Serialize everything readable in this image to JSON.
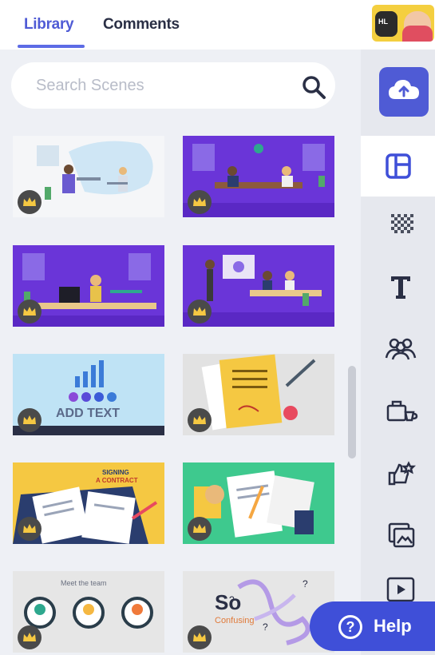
{
  "header": {
    "tabs": [
      {
        "label": "Library",
        "active": true
      },
      {
        "label": "Comments",
        "active": false
      }
    ],
    "avatar_badge": "HL"
  },
  "search": {
    "placeholder": "Search Scenes"
  },
  "scenes": [
    {
      "name": "office-desk-scene",
      "premium": true
    },
    {
      "name": "meeting-table-scene",
      "premium": true
    },
    {
      "name": "workspace-desk-scene",
      "premium": true
    },
    {
      "name": "presentation-scene",
      "premium": true
    },
    {
      "name": "growth-chart-scene",
      "premium": true,
      "caption": "ADD TEXT"
    },
    {
      "name": "signed-document-scene",
      "premium": true
    },
    {
      "name": "signing-contract-scene",
      "premium": true,
      "caption_line1": "SIGNING",
      "caption_line2": "A CONTRACT"
    },
    {
      "name": "documents-desk-scene",
      "premium": true
    },
    {
      "name": "meet-the-team-scene",
      "premium": true,
      "caption": "Meet the team"
    },
    {
      "name": "so-confusing-scene",
      "premium": true,
      "caption_line1": "So",
      "caption_line2": "Confusing"
    }
  ],
  "sidebar": {
    "items": [
      "upload",
      "scenes",
      "backgrounds",
      "text",
      "characters",
      "props",
      "icons",
      "images",
      "videos"
    ]
  },
  "help": {
    "label": "Help",
    "icon_char": "?"
  },
  "colors": {
    "accent": "#4f5bd5",
    "help_bg": "#3f4fd8",
    "panel_bg": "#eef0f5",
    "sidebar_bg": "#e6e8ee"
  }
}
